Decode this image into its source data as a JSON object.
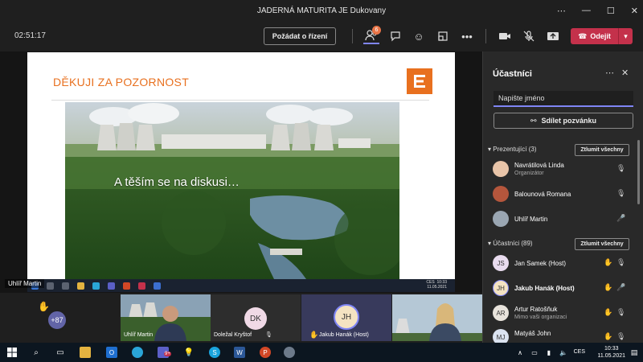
{
  "window": {
    "title": "JADERNÁ MATURITA JE Dukovany"
  },
  "toolbar": {
    "timer": "02:51:17",
    "request_control_label": "Požádat o řízení",
    "participants_badge": "6",
    "leave_label": "Odejít"
  },
  "slide": {
    "title": "DĚKUJI ZA POZORNOST",
    "caption": "A těším se na diskusi…",
    "presenter_label": "Uhlíř Martin",
    "shared_clock_time": "10:33",
    "shared_clock_date": "11.05.2021",
    "shared_lang": "CES"
  },
  "strip": {
    "overflow_count": "+87",
    "tiles": [
      {
        "initials": "CL"
      },
      {
        "name": "Uhlíř Martin"
      },
      {
        "initials": "DK",
        "name": "Doležal Kryštof"
      },
      {
        "initials": "JH",
        "name": "Jakub Hanák (Host)"
      },
      {
        "name": ""
      }
    ]
  },
  "panel": {
    "title": "Účastníci",
    "search_placeholder": "Napište jméno",
    "share_invite_label": "Sdílet pozvánku",
    "presenters_header": "Prezentující (3)",
    "mute_all_label": "Ztlumit všechny",
    "attendees_header": "Účastníci (89)",
    "presenters": [
      {
        "name": "Navrátilová Linda",
        "role": "Organizátor"
      },
      {
        "name": "Balounová Romana",
        "role": ""
      },
      {
        "name": "Uhlíř Martin",
        "role": ""
      }
    ],
    "attendees": [
      {
        "initials": "JS",
        "name": "Jan Samek (Host)",
        "role": ""
      },
      {
        "initials": "JH",
        "name": "Jakub Hanák (Host)",
        "role": ""
      },
      {
        "initials": "AR",
        "name": "Artur Ratošňuk",
        "role": "Mimo vaši organizaci"
      },
      {
        "initials": "MJ",
        "name": "Matyáš John",
        "role": ""
      }
    ]
  },
  "taskbar": {
    "time": "10:33",
    "date": "11.05.2021",
    "lang": "CES",
    "teams_badge": "9+"
  }
}
